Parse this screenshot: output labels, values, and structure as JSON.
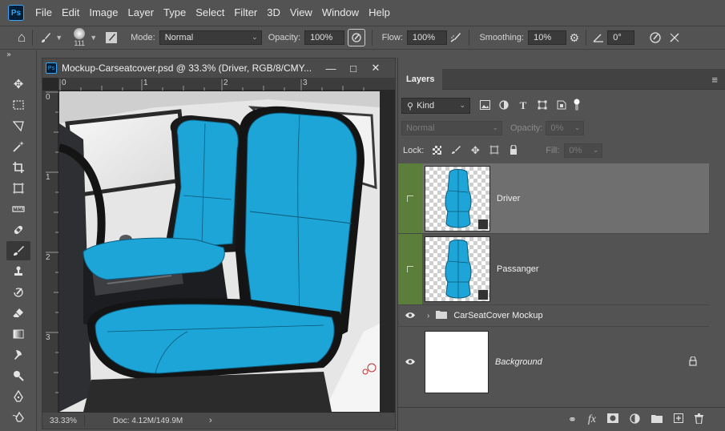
{
  "app": {
    "logo_text": "Ps"
  },
  "menu": [
    "File",
    "Edit",
    "Image",
    "Layer",
    "Type",
    "Select",
    "Filter",
    "3D",
    "View",
    "Window",
    "Help"
  ],
  "options": {
    "brush_size": "111",
    "mode_label": "Mode:",
    "mode_value": "Normal",
    "opacity_label": "Opacity:",
    "opacity_value": "100%",
    "flow_label": "Flow:",
    "flow_value": "100%",
    "smoothing_label": "Smoothing:",
    "smoothing_value": "10%",
    "angle_value": "0°"
  },
  "document": {
    "title": "Mockup-Carseatcover.psd @ 33.3% (Driver, RGB/8/CMY...",
    "ruler_h": [
      "0",
      "1",
      "2",
      "3"
    ],
    "ruler_v": [
      "0",
      "1",
      "2",
      "3"
    ],
    "zoom": "33.33%",
    "doc_info": "Doc: 4.12M/149.9M",
    "seat_color": "#1ea5d8"
  },
  "layers_panel": {
    "tab_label": "Layers",
    "filter_kind": "Kind",
    "blend_mode": "Normal",
    "opacity_label": "Opacity:",
    "opacity_value": "0%",
    "lock_label": "Lock:",
    "fill_label": "Fill:",
    "fill_value": "0%",
    "layers": [
      {
        "name": "Driver",
        "selected": true
      },
      {
        "name": "Passanger",
        "selected": false
      },
      {
        "name": "CarSeatCover Mockup",
        "selected": false
      },
      {
        "name": "Background",
        "selected": false
      }
    ]
  }
}
